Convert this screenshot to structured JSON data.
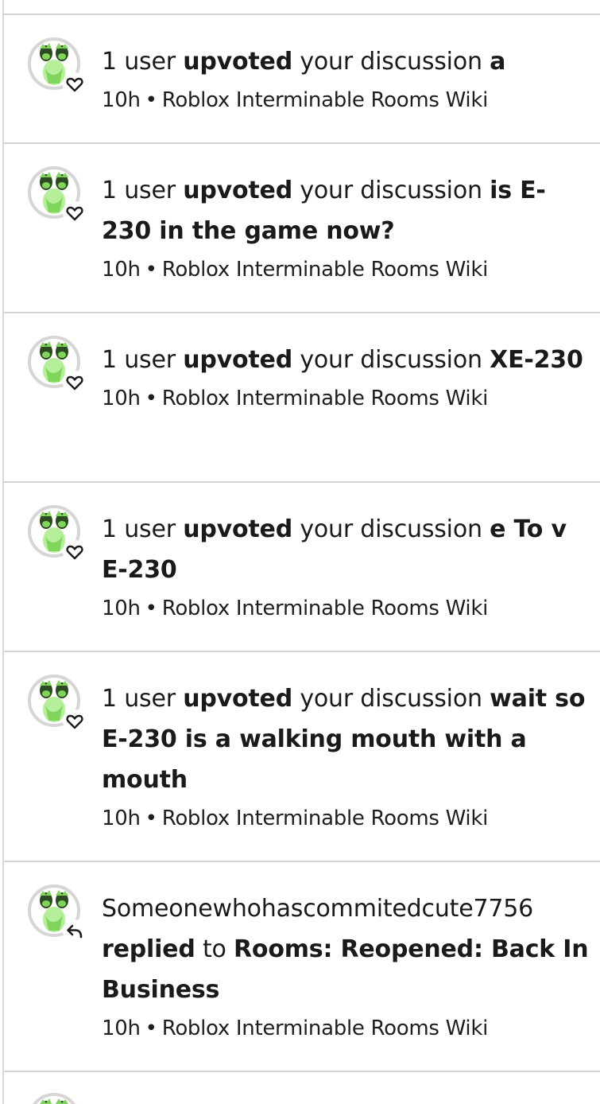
{
  "notifications": [
    {
      "actor": "1 user",
      "action": "upvoted",
      "connector": "your discussion",
      "subject": "a",
      "time": "10h",
      "separator": "•",
      "wiki": "Roblox Interminable Rooms Wiki",
      "badge_icon": "heart-icon"
    },
    {
      "actor": "1 user",
      "action": "upvoted",
      "connector": "your discussion",
      "subject": "is E-230 in the game now?",
      "time": "10h",
      "separator": "•",
      "wiki": "Roblox Interminable Rooms Wiki",
      "badge_icon": "heart-icon"
    },
    {
      "actor": "1 user",
      "action": "upvoted",
      "connector": "your discussion",
      "subject": "XE-230",
      "time": "10h",
      "separator": "•",
      "wiki": "Roblox Interminable Rooms Wiki",
      "badge_icon": "heart-icon"
    },
    {
      "actor": "1 user",
      "action": "upvoted",
      "connector": "your discussion",
      "subject": "e To v E-230",
      "time": "10h",
      "separator": "•",
      "wiki": "Roblox Interminable Rooms Wiki",
      "badge_icon": "heart-icon"
    },
    {
      "actor": "1 user",
      "action": "upvoted",
      "connector": "your discussion",
      "subject": "wait so E-230 is a walking mouth with a mouth",
      "time": "10h",
      "separator": "•",
      "wiki": "Roblox Interminable Rooms Wiki",
      "badge_icon": "heart-icon"
    },
    {
      "actor": "Someonewhohascommitedcute7756",
      "action": "replied",
      "connector": "to",
      "subject": "Rooms: Reopened: Back In Business",
      "time": "10h",
      "separator": "•",
      "wiki": "Roblox Interminable Rooms Wiki",
      "badge_icon": "reply-arrow-icon"
    }
  ],
  "colors": {
    "avatar_green": "#7fd65a",
    "avatar_dark": "#2e4a22",
    "divider": "#d4d4d4",
    "text": "#1a1a1a"
  }
}
